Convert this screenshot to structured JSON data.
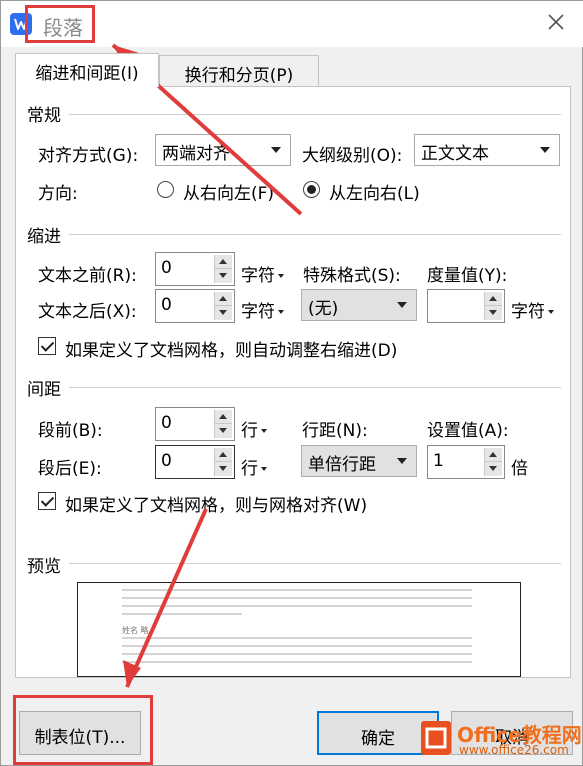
{
  "dialog": {
    "title": "段落",
    "close_icon": "close-icon"
  },
  "tabs": [
    {
      "label": "缩进和间距(I)",
      "active": true
    },
    {
      "label": "换行和分页(P)",
      "active": false
    }
  ],
  "general": {
    "section_label": "常规",
    "alignment_label": "对齐方式(G):",
    "alignment_value": "两端对齐",
    "outline_label": "大纲级别(O):",
    "outline_value": "正文文本",
    "direction_label": "方向:",
    "rtl_label": "从右向左(F)",
    "ltr_label": "从左向右(L)",
    "direction_selected": "ltr"
  },
  "indent": {
    "section_label": "缩进",
    "before_label": "文本之前(R):",
    "before_value": "0",
    "before_unit": "字符",
    "after_label": "文本之后(X):",
    "after_value": "0",
    "after_unit": "字符",
    "special_label": "特殊格式(S):",
    "special_value": "(无)",
    "measure_label": "度量值(Y):",
    "measure_value": "",
    "measure_unit": "字符",
    "auto_adjust_label": "如果定义了文档网格，则自动调整右缩进(D)",
    "auto_adjust_checked": true
  },
  "spacing": {
    "section_label": "间距",
    "before_label": "段前(B):",
    "before_value": "0",
    "before_unit": "行",
    "after_label": "段后(E):",
    "after_value": "0",
    "after_unit": "行",
    "line_spacing_label": "行距(N):",
    "line_spacing_value": "单倍行距",
    "set_value_label": "设置值(A):",
    "set_value": "1",
    "set_value_unit": "倍",
    "snap_grid_label": "如果定义了文档网格，则与网格对齐(W)",
    "snap_grid_checked": true
  },
  "preview": {
    "section_label": "预览",
    "sample_text": "姓名 略"
  },
  "buttons": {
    "tabs_label": "制表位(T)...",
    "ok_label": "确定",
    "cancel_label": "取消"
  },
  "watermark": {
    "brand": "Office教程网",
    "url": "www.office26.com"
  },
  "colors": {
    "annotation_red": "#e03c3c",
    "accent_blue": "#0078d7",
    "brand_orange": "#e8511f"
  }
}
